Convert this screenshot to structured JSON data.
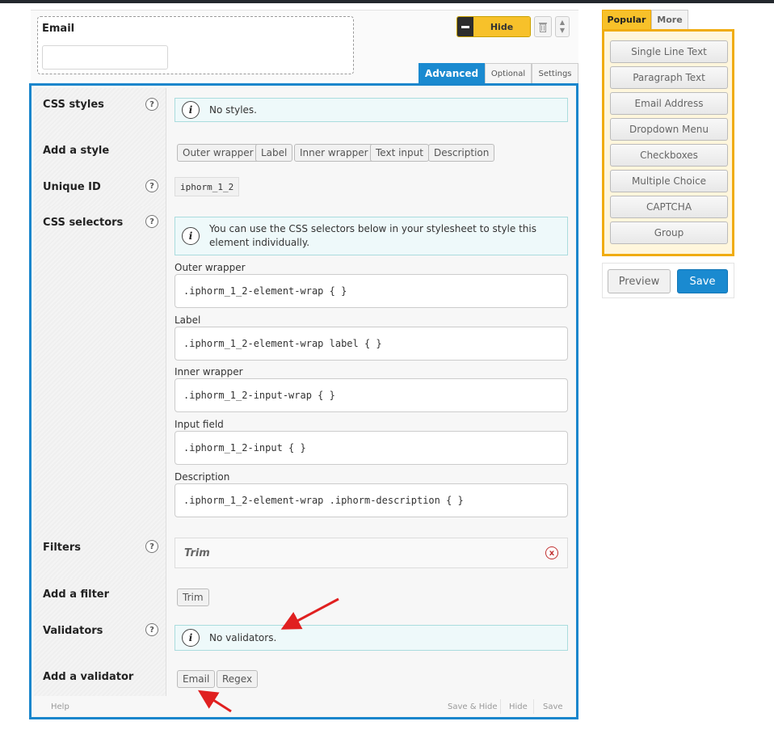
{
  "element": {
    "label": "Email",
    "hide_label": "Hide",
    "tabs": [
      "Advanced",
      "Optional",
      "Settings"
    ]
  },
  "advanced": {
    "css_styles": {
      "label": "CSS styles",
      "notice": "No styles."
    },
    "add_style": {
      "label": "Add a style",
      "buttons": [
        "Outer wrapper",
        "Label",
        "Inner wrapper",
        "Text input",
        "Description"
      ]
    },
    "unique_id": {
      "label": "Unique ID",
      "value": "iphorm_1_2"
    },
    "css_selectors": {
      "label": "CSS selectors",
      "notice": "You can use the CSS selectors below in your stylesheet to style this element individually.",
      "items": [
        {
          "label": "Outer wrapper",
          "value": ".iphorm_1_2-element-wrap { }"
        },
        {
          "label": "Label",
          "value": ".iphorm_1_2-element-wrap label { }"
        },
        {
          "label": "Inner wrapper",
          "value": ".iphorm_1_2-input-wrap { }"
        },
        {
          "label": "Input field",
          "value": ".iphorm_1_2-input { }"
        },
        {
          "label": "Description",
          "value": ".iphorm_1_2-element-wrap .iphorm-description { }"
        }
      ]
    },
    "filters": {
      "label": "Filters",
      "items": [
        "Trim"
      ]
    },
    "add_filter": {
      "label": "Add a filter",
      "buttons": [
        "Trim"
      ]
    },
    "validators": {
      "label": "Validators",
      "notice": "No validators."
    },
    "add_validator": {
      "label": "Add a validator",
      "buttons": [
        "Email",
        "Regex"
      ]
    },
    "help_glyph": "?",
    "info_glyph": "i",
    "remove_glyph": "x"
  },
  "footer": {
    "help": "Help",
    "save_hide": "Save & Hide",
    "hide": "Hide",
    "save": "Save"
  },
  "sidebar": {
    "tabs": [
      "Popular",
      "More"
    ],
    "buttons": [
      "Single Line Text",
      "Paragraph Text",
      "Email Address",
      "Dropdown Menu",
      "Checkboxes",
      "Multiple Choice",
      "CAPTCHA",
      "Group"
    ],
    "preview": "Preview",
    "save": "Save"
  },
  "colors": {
    "accent": "#1a86cc",
    "hide_yellow": "#f7c12a",
    "sidebar_border": "#f0ac10",
    "arrow": "#e02020"
  },
  "icons": {
    "trash": "trash-icon",
    "reorder": "up-down-arrows-icon",
    "info": "info-icon",
    "help": "help-icon",
    "remove": "remove-icon"
  }
}
